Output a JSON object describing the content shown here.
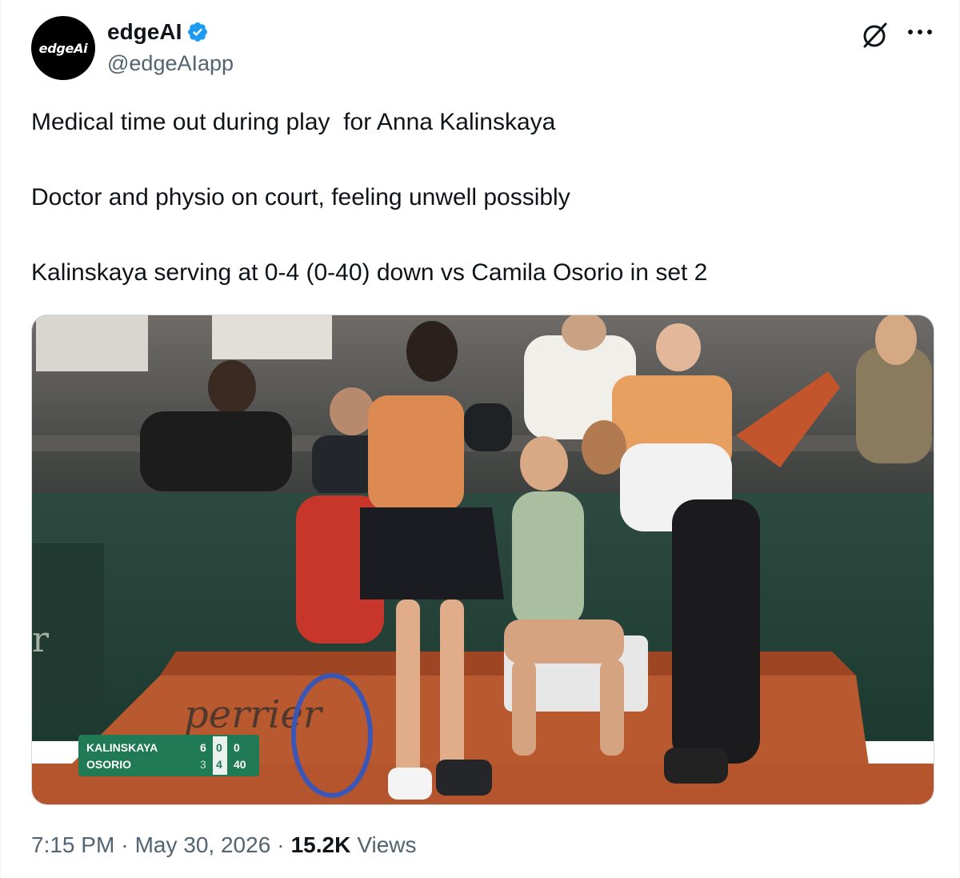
{
  "author": {
    "display_name": "edgeAI",
    "handle": "@edgeAIapp",
    "avatar_text": "edgeAi",
    "verified": true
  },
  "tweet": {
    "lines": [
      "Medical time out during play  for Anna Kalinskaya",
      "Doctor and physio on court, feeling unwell possibly",
      "Kalinskaya serving at 0-4 (0-40) down vs Camila Osorio in set 2"
    ]
  },
  "media": {
    "scoreboard": {
      "rows": [
        {
          "player": "KALINSKAYA",
          "set1": "6",
          "set2": "0",
          "game": "0"
        },
        {
          "player": "OSORIO",
          "set1": "3",
          "set2": "4",
          "game": "40"
        }
      ]
    },
    "sponsor_text": "perrier"
  },
  "meta": {
    "time": "7:15 PM",
    "separator": "·",
    "date": "May 30, 2026",
    "views_count": "15.2K",
    "views_label": "Views"
  },
  "icons": {
    "verified": "verified-badge-icon",
    "grok": "grok-icon",
    "more": "more-icon"
  },
  "colors": {
    "verified_blue": "#1d9bf0",
    "text_primary": "#0f1419",
    "text_secondary": "#536471",
    "scoreboard_green": "#1f7a55",
    "clay": "#b4552e"
  }
}
